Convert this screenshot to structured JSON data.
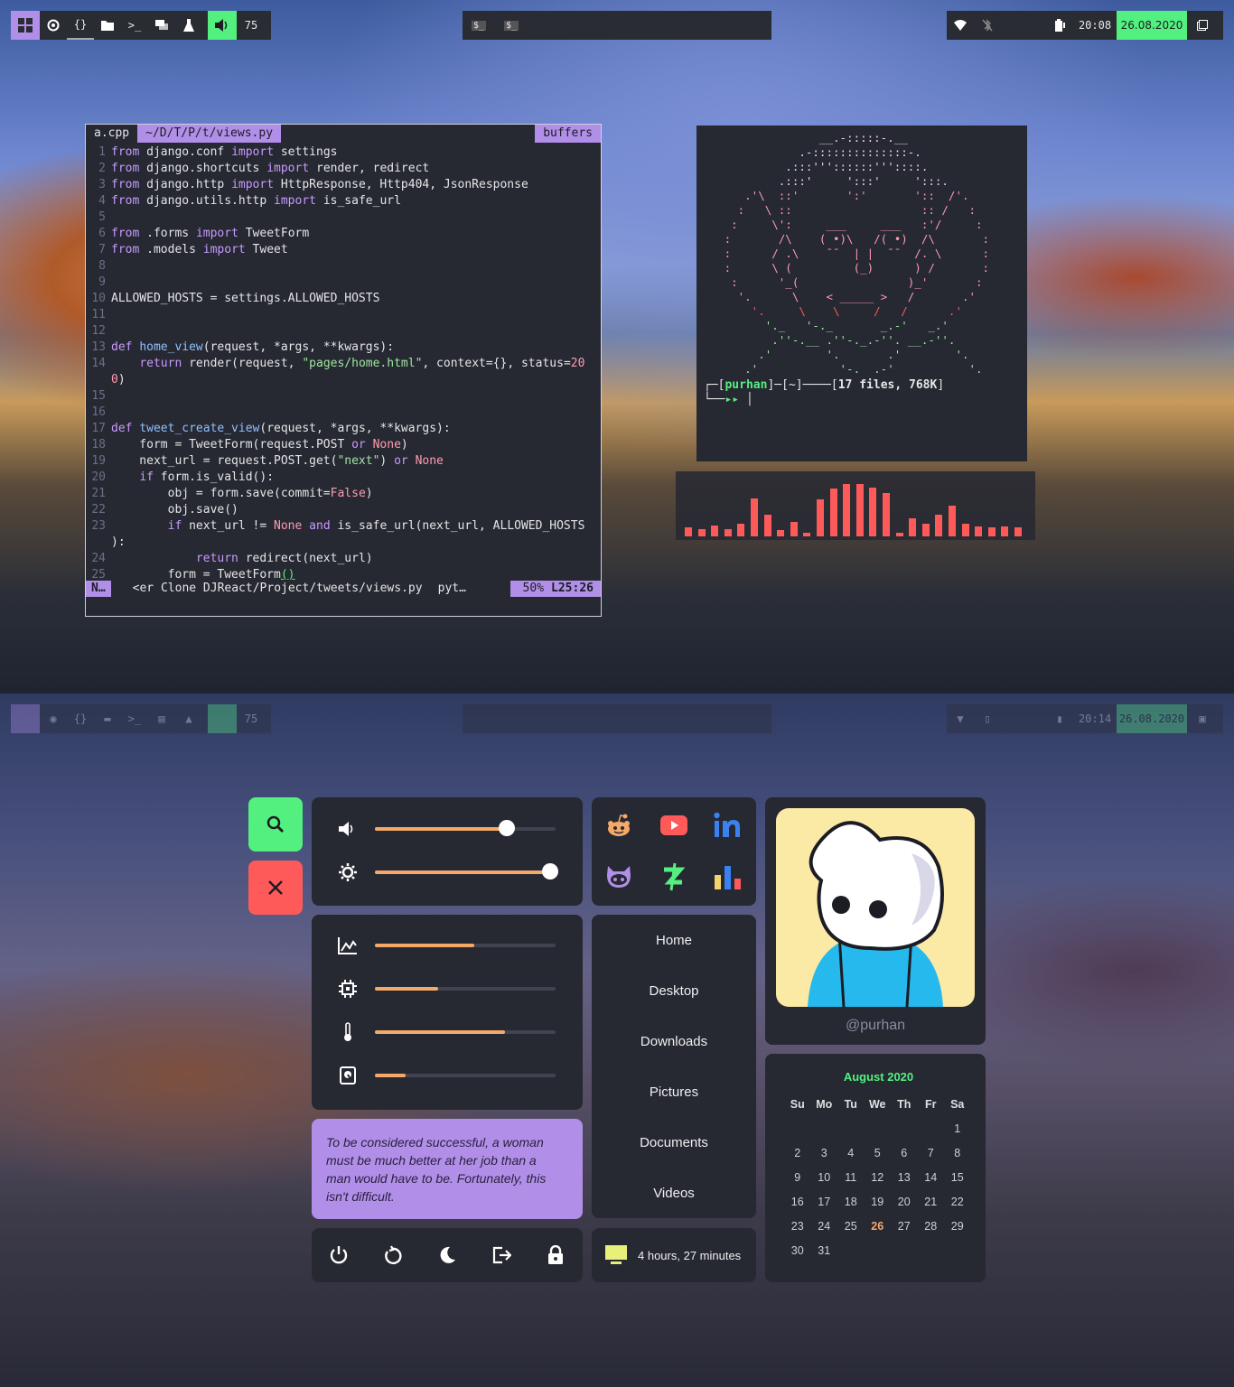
{
  "top_bar": {
    "workspace_label": "75",
    "clock": "20:08",
    "date": "26.08.2020",
    "launcher_items": [
      "$_",
      "$_"
    ]
  },
  "bottom_bar": {
    "workspace_label": "75",
    "clock": "20:14",
    "date": "26.08.2020"
  },
  "editor": {
    "tabs": [
      "a.cpp",
      "~/D/T/P/t/views.py",
      "buffers"
    ],
    "status": {
      "mode": "N…",
      "file": "<er Clone DJReact/Project/tweets/views.py",
      "filetype": "pyt…",
      "percent": "50%",
      "position": "L25:26"
    }
  },
  "ascii": {
    "prompt_user": "purhan",
    "prompt_dir": "~",
    "prompt_info": "17 files, 768K",
    "prompt_arrow": "▸▸"
  },
  "visualizer": {
    "color": "#ff5a5a",
    "levels": [
      0.15,
      0.12,
      0.18,
      0.12,
      0.2,
      0.62,
      0.35,
      0.1,
      0.24,
      0.06,
      0.6,
      0.78,
      0.86,
      0.86,
      0.8,
      0.7,
      0.06,
      0.3,
      0.2,
      0.36,
      0.5,
      0.2,
      0.16,
      0.14,
      0.16,
      0.14
    ]
  },
  "dashboard": {
    "sliders": [
      {
        "name": "volume",
        "icon": "volume-icon",
        "value": 0.73,
        "knob": true
      },
      {
        "name": "brightness",
        "icon": "brightness-icon",
        "value": 0.97,
        "knob": true
      }
    ],
    "stats": [
      {
        "name": "ram",
        "icon": "chart-icon",
        "value": 0.55
      },
      {
        "name": "cpu",
        "icon": "cpu-icon",
        "value": 0.35
      },
      {
        "name": "temperature",
        "icon": "thermometer-icon",
        "value": 0.72
      },
      {
        "name": "disk",
        "icon": "disk-icon",
        "value": 0.17
      }
    ],
    "quote": "To be considered successful, a woman must be much better at her job than a man would have to be. Fortunately, this isn't difficult.",
    "apps": [
      "reddit-icon",
      "youtube-icon",
      "linkedin-icon",
      "github-icon",
      "zulip-icon",
      "stats-icon"
    ],
    "places": [
      "Home",
      "Desktop",
      "Downloads",
      "Pictures",
      "Documents",
      "Videos"
    ],
    "uptime": "4 hours, 27 minutes",
    "username": "@purhan",
    "calendar": {
      "month": "August 2020",
      "weekdays": [
        "Su",
        "Mo",
        "Tu",
        "We",
        "Th",
        "Fr",
        "Sa"
      ],
      "weeks": [
        [
          "",
          "",
          "",
          "",
          "",
          "",
          "1"
        ],
        [
          "2",
          "3",
          "4",
          "5",
          "6",
          "7",
          "8"
        ],
        [
          "9",
          "10",
          "11",
          "12",
          "13",
          "14",
          "15"
        ],
        [
          "16",
          "17",
          "18",
          "19",
          "20",
          "21",
          "22"
        ],
        [
          "23",
          "24",
          "25",
          "26",
          "27",
          "28",
          "29"
        ],
        [
          "30",
          "31",
          "",
          "",
          "",
          "",
          ""
        ]
      ],
      "today": "26"
    }
  },
  "colors": {
    "accent": "#b18fe8",
    "green": "#53f080",
    "red": "#ff5a5a",
    "orange": "#f5a968",
    "panel": "#262832"
  }
}
